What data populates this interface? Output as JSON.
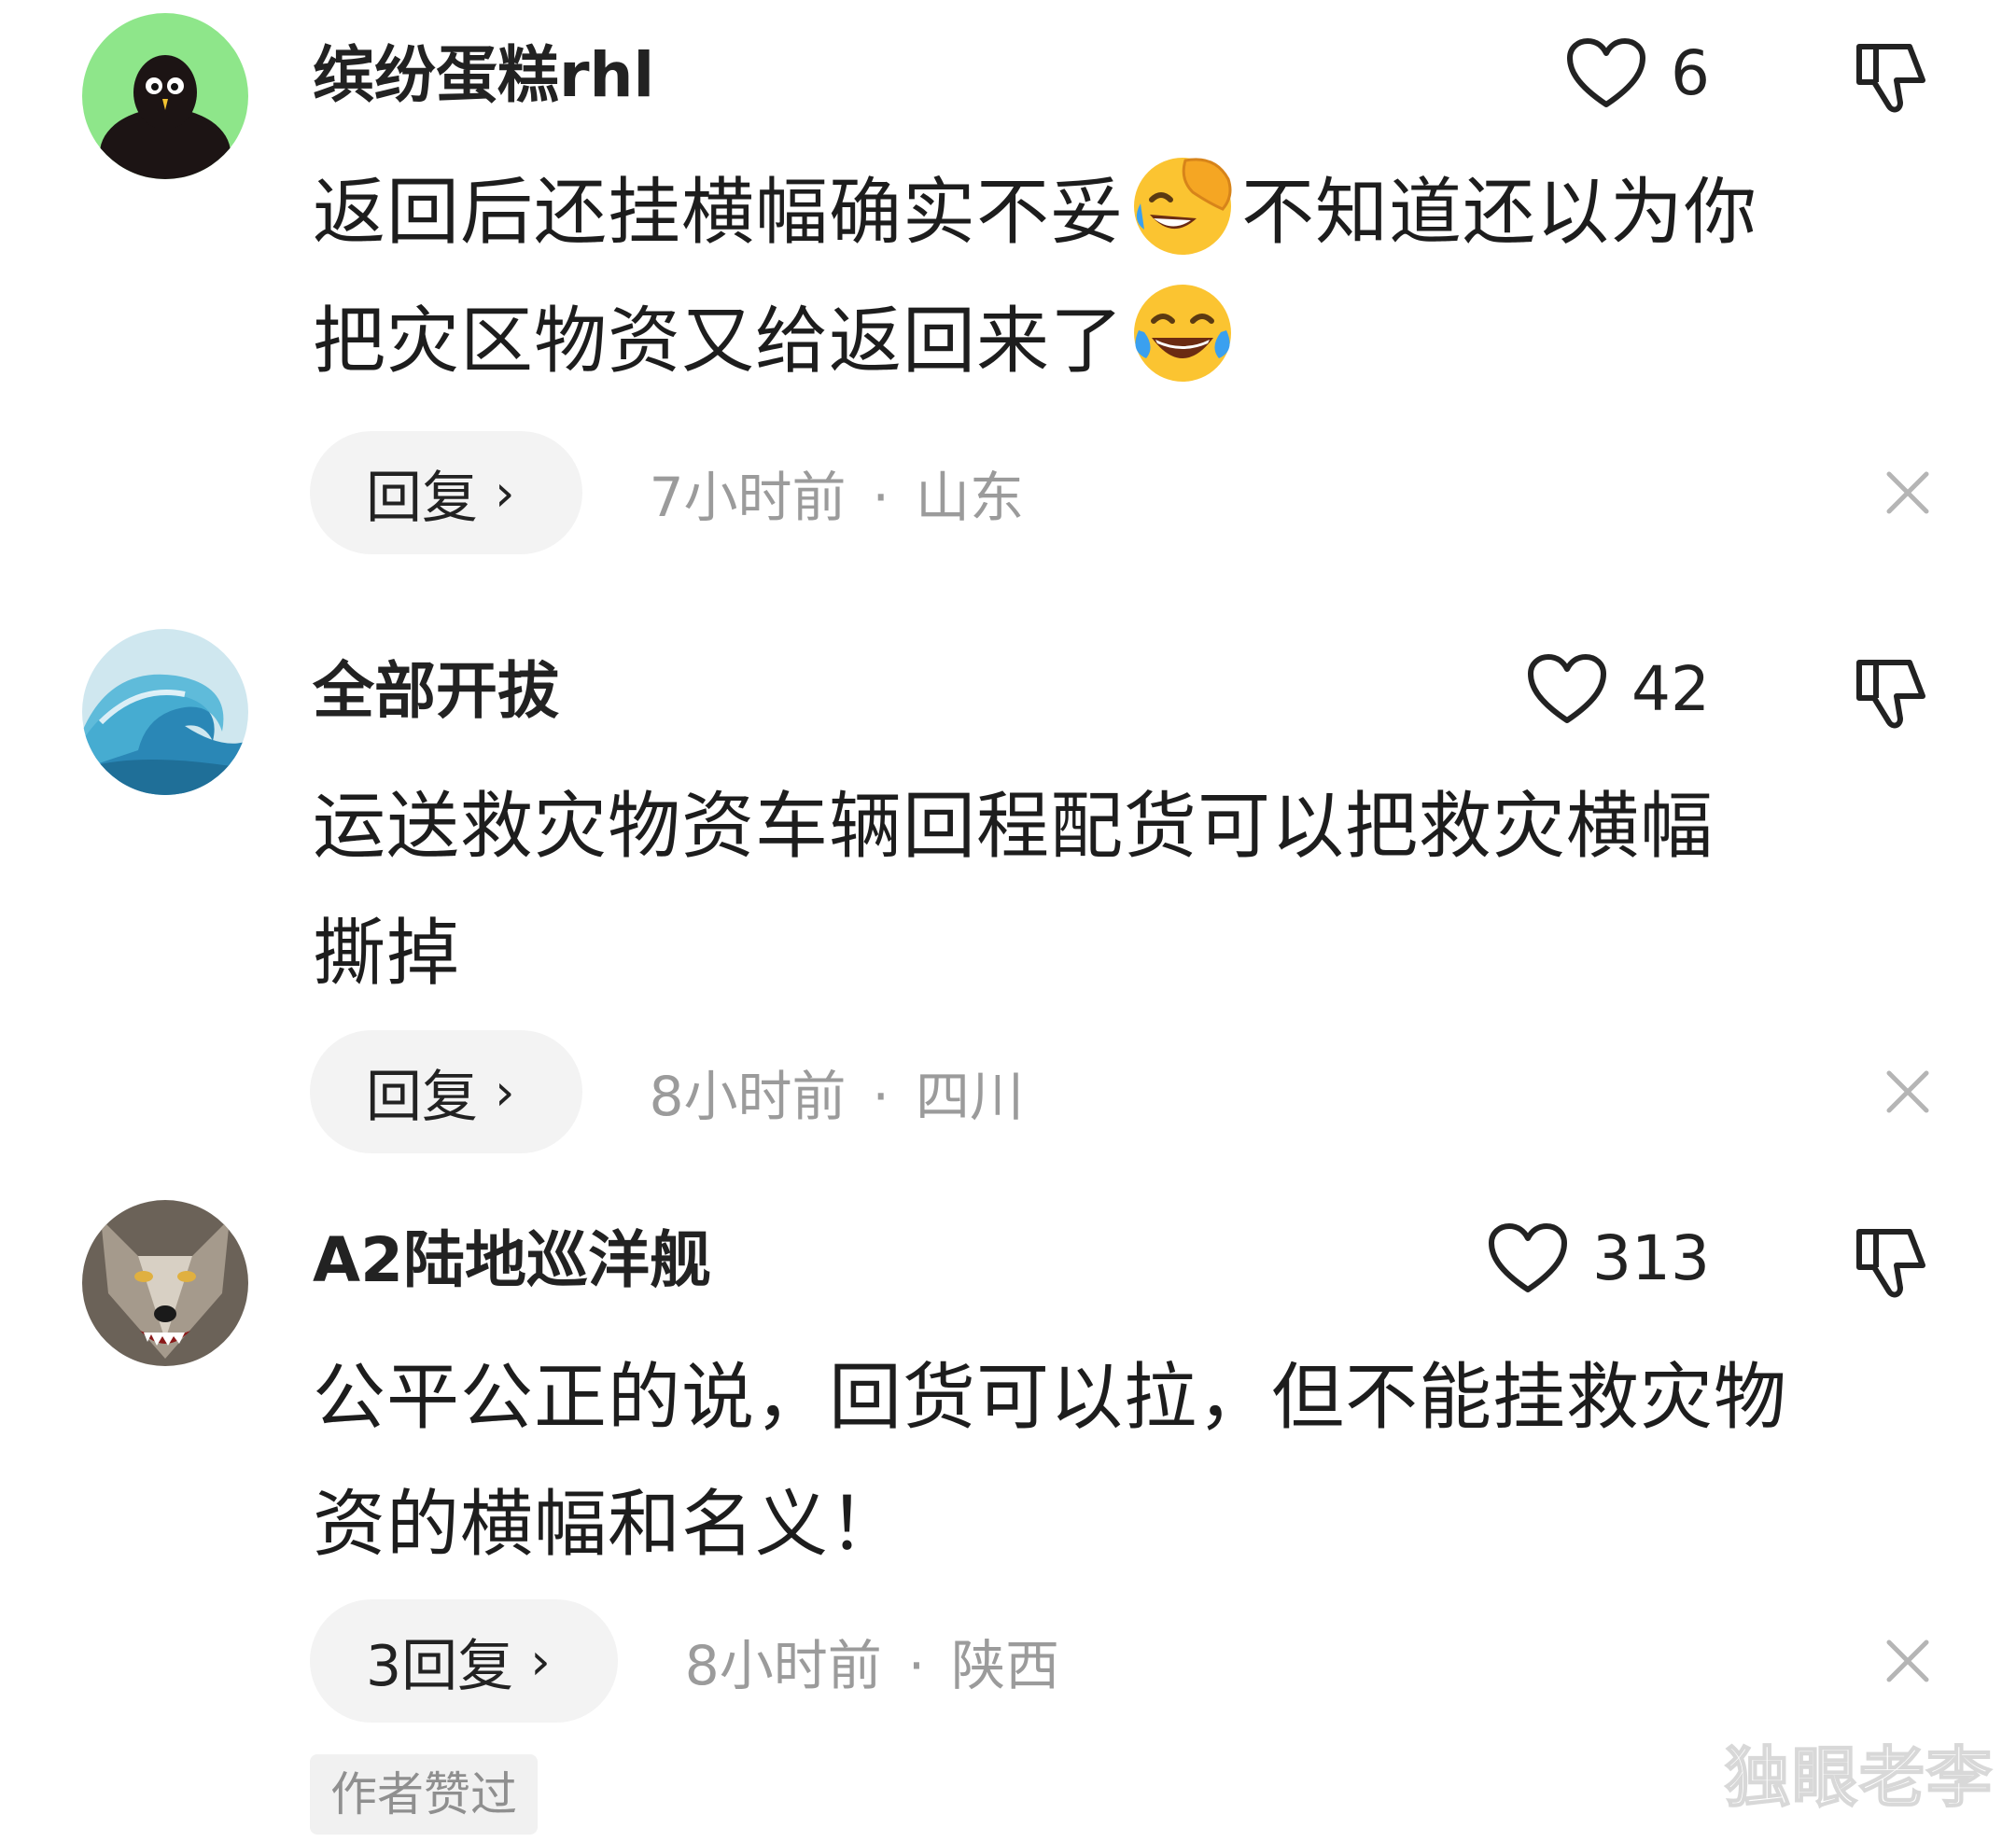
{
  "comments": [
    {
      "username": "缤纷蛋糕rhl",
      "like_count": "6",
      "text_lines": [
        [
          "返回后还挂横幅确实不妥",
          "不知道还以为你"
        ],
        [
          "把灾区物资又给返回来了",
          ""
        ]
      ],
      "emojis": [
        "face-with-hand-laughing-emoji",
        "tears-of-joy-emoji"
      ],
      "reply_label": "回复",
      "time": "7小时前",
      "location": "山东",
      "avatar_icon": "penguin-avatar",
      "avatar_bg": "#8ee68a"
    },
    {
      "username": "全部开拔",
      "like_count": "42",
      "text_lines": [
        [
          "运送救灾物资车辆回程配货可以把救灾横幅"
        ],
        [
          "撕掉"
        ]
      ],
      "reply_label": "回复",
      "time": "8小时前",
      "location": "四川",
      "avatar_icon": "ocean-wave-avatar"
    },
    {
      "username": "A2陆地巡洋舰",
      "like_count": "313",
      "text_lines": [
        [
          "公平公正的说，回货可以拉，但不能挂救灾物"
        ],
        [
          "资的横幅和名义！"
        ]
      ],
      "reply_label": "3回复",
      "time": "8小时前",
      "location": "陕西",
      "author_liked": "作者赞过",
      "avatar_icon": "wolf-avatar"
    }
  ],
  "separator": "·",
  "chevron": "›",
  "watermark": "独眼老李",
  "colors": {
    "meta_gray": "#9b9b9b",
    "pill_bg": "#f3f3f3"
  }
}
